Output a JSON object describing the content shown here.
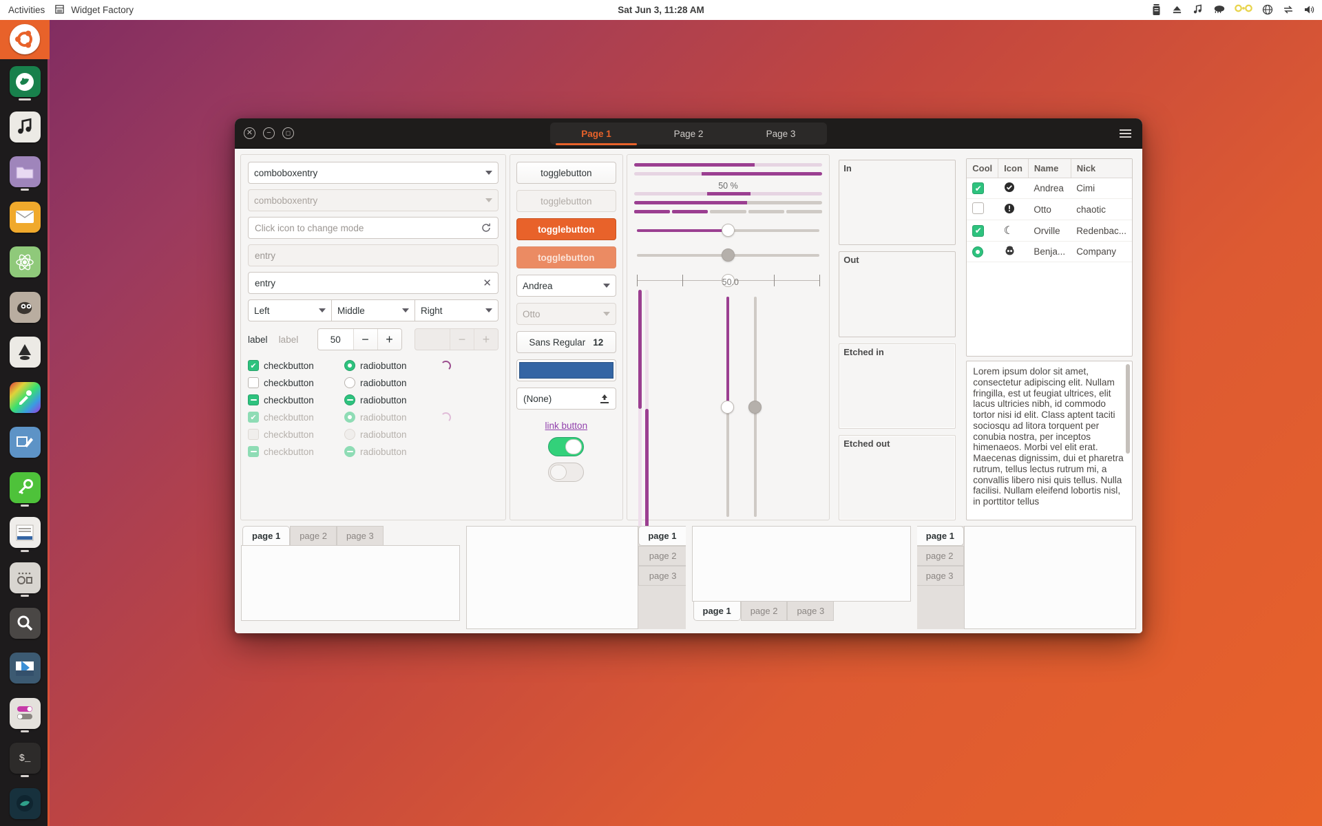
{
  "topbar": {
    "activities": "Activities",
    "app_name": "Widget Factory",
    "app_icon": "window-icon",
    "clock": "Sat Jun  3, 11:28 AM",
    "sys_icons": [
      "battery-icon",
      "eject-icon",
      "music-note-icon",
      "cloud-icon",
      "nextcloud-icon",
      "network-icon",
      "sync-icon",
      "volume-icon"
    ]
  },
  "dock": {
    "items": [
      {
        "name": "ubuntu-logo",
        "glyph": "◉",
        "bg": "#e8622a",
        "running": false
      },
      {
        "name": "firefox",
        "glyph": "🦊",
        "bg": "#1a7a4c",
        "running": true
      },
      {
        "name": "rhythmbox",
        "glyph": "♪",
        "bg": "#e8e6e1",
        "running": false
      },
      {
        "name": "files",
        "glyph": "🗀",
        "bg": "#a68cc0",
        "running": true
      },
      {
        "name": "thunderbird",
        "glyph": "✉",
        "bg": "#f0a92c",
        "running": false
      },
      {
        "name": "science-app",
        "glyph": "⚛",
        "bg": "#8fc97a",
        "running": false
      },
      {
        "name": "gimp",
        "glyph": "🐺",
        "bg": "#b9ada0",
        "running": false
      },
      {
        "name": "inkscape",
        "glyph": "✒",
        "bg": "#e6e4e0",
        "running": false
      },
      {
        "name": "color-picker",
        "glyph": "✐",
        "bg": "#8f4fd0",
        "running": false
      },
      {
        "name": "screenshot-tool",
        "glyph": "🖉",
        "bg": "#5d93c6",
        "running": false
      },
      {
        "name": "password-manager",
        "glyph": "🔑",
        "bg": "#56c442",
        "running": true
      },
      {
        "name": "text-editor",
        "glyph": "▤",
        "bg": "#e2e0dc",
        "running": true
      },
      {
        "name": "settings-panel",
        "glyph": "▦",
        "bg": "#c9c6c1",
        "running": true
      },
      {
        "name": "search-tool",
        "glyph": "🔍",
        "bg": "#4a4745",
        "running": false
      },
      {
        "name": "vscode",
        "glyph": "◧",
        "bg": "#3c5a72",
        "running": false
      },
      {
        "name": "toggles-app",
        "glyph": "◑",
        "bg": "#dedbd6",
        "running": true
      },
      {
        "name": "terminal",
        "glyph": "$_",
        "bg": "#2d2b2a",
        "running": true
      },
      {
        "name": "globe-app",
        "glyph": "◍",
        "bg": "#17313d",
        "running": false
      }
    ]
  },
  "window": {
    "controls": [
      {
        "name": "close-button",
        "glyph": "✕"
      },
      {
        "name": "minimize-button",
        "glyph": "−"
      },
      {
        "name": "maximize-button",
        "glyph": "◻"
      }
    ],
    "tabs": [
      {
        "label": "Page 1",
        "active": true
      },
      {
        "label": "Page 2",
        "active": false
      },
      {
        "label": "Page 3",
        "active": false
      }
    ],
    "menu_icon": "hamburger-menu-icon"
  },
  "col1": {
    "combo_entry_1": "comboboxentry",
    "combo_entry_2": "comboboxentry",
    "icon_entry_placeholder": "Click icon to change mode",
    "icon_entry_icon": "refresh-icon",
    "entry_disabled_placeholder": "entry",
    "entry_value": "entry",
    "entry_clear_icon": "clear-icon",
    "align_combos": [
      "Left",
      "Middle",
      "Right"
    ],
    "label_enabled": "label",
    "label_disabled": "label",
    "spin_value": "50",
    "spin_minus": "−",
    "spin_plus": "+",
    "spin2_minus": "−",
    "spin2_plus": "+",
    "rows": [
      {
        "check": "checkbutton",
        "check_state": "checked",
        "radio": "radiobutton",
        "radio_state": "checked",
        "spinner": true,
        "disabled": false
      },
      {
        "check": "checkbutton",
        "check_state": "unchecked",
        "radio": "radiobutton",
        "radio_state": "unchecked",
        "spinner": false,
        "disabled": false
      },
      {
        "check": "checkbutton",
        "check_state": "mixed",
        "radio": "radiobutton",
        "radio_state": "mixed",
        "spinner": false,
        "disabled": false
      },
      {
        "check": "checkbutton",
        "check_state": "checked",
        "radio": "radiobutton",
        "radio_state": "checked",
        "spinner": true,
        "disabled": true
      },
      {
        "check": "checkbutton",
        "check_state": "unchecked",
        "radio": "radiobutton",
        "radio_state": "unchecked",
        "spinner": false,
        "disabled": true
      },
      {
        "check": "checkbutton",
        "check_state": "mixed",
        "radio": "radiobutton",
        "radio_state": "mixed",
        "spinner": false,
        "disabled": true
      }
    ]
  },
  "col2": {
    "toggle_1": "togglebutton",
    "toggle_2": "togglebutton",
    "toggle_3": "togglebutton",
    "toggle_4": "togglebutton",
    "combo_name": "Andrea",
    "combo_name_disabled": "Otto",
    "font_name": "Sans Regular",
    "font_size": "12",
    "color_value": "#3465a4",
    "file_value": "(None)",
    "file_icon": "upload-icon",
    "link_label": "link button",
    "switch_on": true,
    "switch_off": false
  },
  "col3": {
    "progress_percent_label": "50 %",
    "progress_1": 64,
    "progress_2": 64,
    "progress_3_start": 39,
    "progress_3_width": 23,
    "progress_4": 60,
    "scale_1_value": 50,
    "scale_2_value": 50,
    "scale_3_value": 50,
    "vertical_value_label": "50.0",
    "vscale_1_value": 50,
    "vscale_2_value": 50
  },
  "col4": {
    "frames": [
      "In",
      "Out",
      "Etched in",
      "Etched out"
    ]
  },
  "col5": {
    "tree": {
      "columns": [
        "Cool",
        "Icon",
        "Name",
        "Nick"
      ],
      "rows": [
        {
          "cool": "checked",
          "icon": "check-circle-icon",
          "icon_glyph": "✔",
          "name": "Andrea",
          "nick": "Cimi"
        },
        {
          "cool": "unchecked",
          "icon": "warning-circle-icon",
          "icon_glyph": "!",
          "name": "Otto",
          "nick": "chaotic"
        },
        {
          "cool": "checked",
          "icon": "moon-icon",
          "icon_glyph": "☾",
          "name": "Orville",
          "nick": "Redenbac..."
        },
        {
          "cool": "radio",
          "icon": "face-monkey-icon",
          "icon_glyph": "🐵",
          "name": "Benja...",
          "nick": "Company"
        }
      ]
    },
    "text": "Lorem ipsum dolor sit amet, consectetur adipiscing elit. Nullam fringilla, est ut feugiat ultrices, elit lacus ultricies nibh, id commodo tortor nisi id elit. Class aptent taciti sociosqu ad litora torquent per conubia nostra, per inceptos himenaeos. Morbi vel elit erat. Maecenas dignissim, dui et pharetra rutrum, tellus lectus rutrum mi, a convallis libero nisi quis tellus. Nulla facilisi. Nullam eleifend lobortis nisl, in porttitor tellus"
  },
  "notebooks": [
    {
      "position": "top",
      "tabs": [
        "page 1",
        "page 2",
        "page 3"
      ],
      "selected": 0
    },
    {
      "position": "right",
      "tabs": [
        "page 1",
        "page 2",
        "page 3"
      ],
      "selected": 0
    },
    {
      "position": "bottom",
      "tabs": [
        "page 1",
        "page 2",
        "page 3"
      ],
      "selected": 0
    },
    {
      "position": "left",
      "tabs": [
        "page 1",
        "page 2",
        "page 3"
      ],
      "selected": 0
    }
  ]
}
